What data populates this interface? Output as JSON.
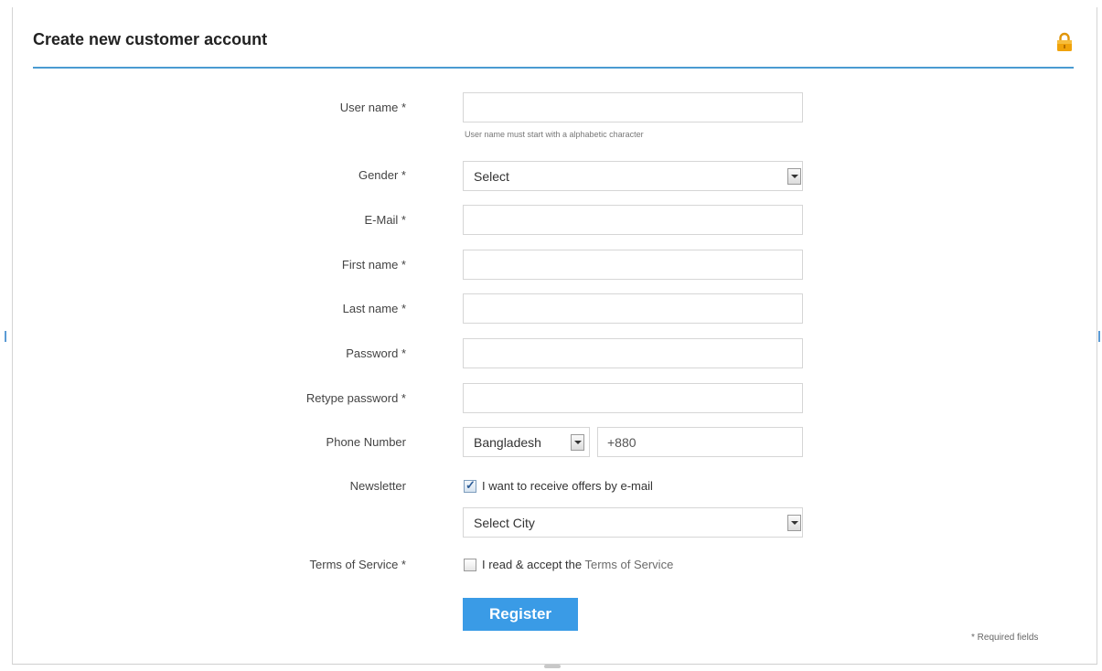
{
  "header": {
    "title": "Create new customer account",
    "lock_icon": "lock-icon"
  },
  "form": {
    "username": {
      "label": "User name *",
      "value": "",
      "hint": "User name must start with a alphabetic character"
    },
    "gender": {
      "label": "Gender *",
      "selected": "Select"
    },
    "email": {
      "label": "E-Mail *",
      "value": ""
    },
    "first_name": {
      "label": "First name *",
      "value": ""
    },
    "last_name": {
      "label": "Last name *",
      "value": ""
    },
    "password": {
      "label": "Password *",
      "value": ""
    },
    "retype_password": {
      "label": "Retype password *",
      "value": ""
    },
    "phone": {
      "label": "Phone Number",
      "country": "Bangladesh",
      "code_value": "+880"
    },
    "newsletter": {
      "label": "Newsletter",
      "checkbox_label": "I want to receive offers by e-mail",
      "checked": true,
      "city_selected": "Select City"
    },
    "terms": {
      "label": "Terms of Service *",
      "prefix": "I read & accept the ",
      "link": "Terms of Service",
      "checked": false
    },
    "register_label": "Register",
    "required_note": "* Required fields"
  },
  "colors": {
    "accent": "#4a9bd1",
    "button": "#3a9be6",
    "lock": "#f0a30a"
  }
}
